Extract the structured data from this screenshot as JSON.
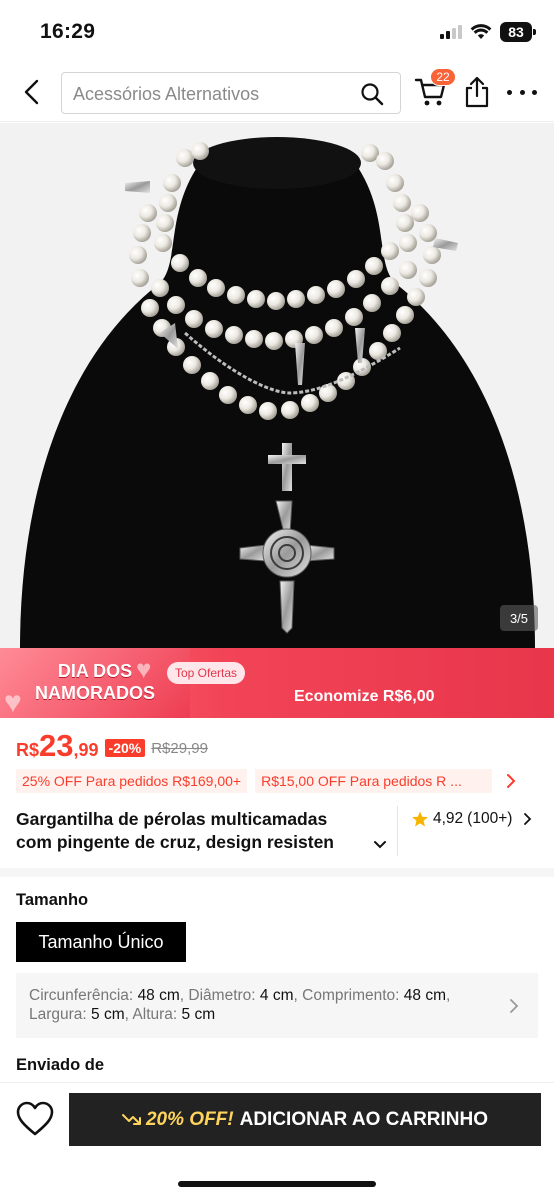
{
  "status_bar": {
    "time": "16:29",
    "battery": "83"
  },
  "top_nav": {
    "search_placeholder": "Acessórios Alternativos",
    "cart_count": "22",
    "icons": [
      "back-arrow-icon",
      "search-icon",
      "cart-icon",
      "share-icon",
      "more-icon"
    ]
  },
  "gallery": {
    "counter": "3/5"
  },
  "promo": {
    "title_line1": "DIA DOS",
    "title_line2": "NAMORADOS",
    "badge": "Top Ofertas",
    "savings": "Economize R$6,00"
  },
  "price": {
    "currency": "R$",
    "integer": "23",
    "decimal": ",99",
    "discount": "-20%",
    "original": "R$29,99",
    "accent_color": "#fa3d2b"
  },
  "coupons": [
    {
      "text": "25% OFF Para pedidos R$169,00+"
    },
    {
      "text": "R$15,00 OFF Para pedidos R ..."
    }
  ],
  "product": {
    "title_line1": "Gargantilha de pérolas multicamadas",
    "title_line2": "com pingente de cruz, design resisten",
    "rating": "4,92",
    "reviews": "(100+)"
  },
  "size": {
    "label": "Tamanho",
    "selected": "Tamanho Único",
    "measurements": [
      {
        "name": "Circunferência:",
        "value": "48 cm"
      },
      {
        "name": "Diâmetro:",
        "value": "4 cm"
      },
      {
        "name": "Comprimento:",
        "value": "48 cm"
      },
      {
        "name": "Largura:",
        "value": "5 cm"
      },
      {
        "name": "Altura:",
        "value": "5 cm"
      }
    ]
  },
  "shipping": {
    "label": "Enviado de"
  },
  "bottom_bar": {
    "promo": "20% OFF!",
    "add_to_cart": "ADICIONAR AO CARRINHO"
  }
}
